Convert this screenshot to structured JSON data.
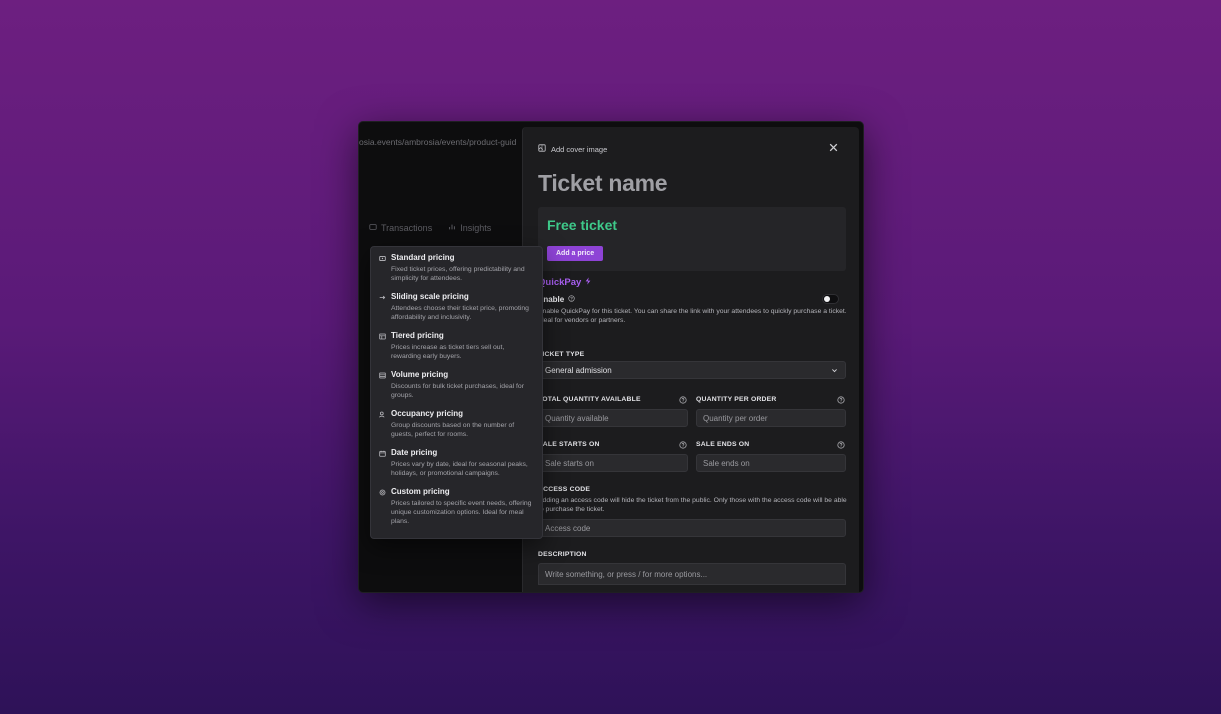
{
  "background_window": {
    "url": "osia.events/ambrosia/events/product-guid",
    "tabs": [
      {
        "label": "Transactions",
        "icon": "card-icon"
      },
      {
        "label": "Insights",
        "icon": "chart-icon"
      }
    ]
  },
  "pricing_menu": {
    "items": [
      {
        "icon": "tag-icon",
        "title": "Standard pricing",
        "desc": "Fixed ticket prices, offering predictability and simplicity for attendees."
      },
      {
        "icon": "arrow-right-icon",
        "title": "Sliding scale pricing",
        "desc": "Attendees choose their ticket price, promoting affordability and inclusivity."
      },
      {
        "icon": "layers-icon",
        "title": "Tiered pricing",
        "desc": "Prices increase as ticket tiers sell out, rewarding early buyers."
      },
      {
        "icon": "stack-icon",
        "title": "Volume pricing",
        "desc": "Discounts for bulk ticket purchases, ideal for groups."
      },
      {
        "icon": "people-icon",
        "title": "Occupancy pricing",
        "desc": "Group discounts based on the number of guests, perfect for rooms."
      },
      {
        "icon": "calendar-icon",
        "title": "Date pricing",
        "desc": "Prices vary by date, ideal for seasonal peaks, holidays, or promotional campaigns."
      },
      {
        "icon": "settings-icon",
        "title": "Custom pricing",
        "desc": "Prices tailored to specific event needs, offering unique customization options. Ideal for meal plans."
      }
    ]
  },
  "panel": {
    "add_cover_label": "Add cover image",
    "ticket_name_placeholder": "Ticket name",
    "free_ticket_label": "Free ticket",
    "add_price_label": "Add a price",
    "quickpay": {
      "title": "QuickPay",
      "enable_label": "Enable",
      "enabled": false,
      "description": "Enable QuickPay for this ticket. You can share the link with your attendees to quickly purchase a ticket. Ideal for vendors or partners."
    },
    "ticket_type": {
      "label": "TICKET TYPE",
      "value": "General admission"
    },
    "total_quantity": {
      "label": "TOTAL QUANTITY AVAILABLE",
      "placeholder": "Quantity available"
    },
    "quantity_per_order": {
      "label": "QUANTITY PER ORDER",
      "placeholder": "Quantity per order"
    },
    "sale_starts": {
      "label": "SALE STARTS ON",
      "placeholder": "Sale starts on"
    },
    "sale_ends": {
      "label": "SALE ENDS ON",
      "placeholder": "Sale ends on"
    },
    "access_code": {
      "label": "ACCESS CODE",
      "description": "Adding an access code will hide the ticket from the public. Only those with the access code will be able to purchase the ticket.",
      "placeholder": "Access code"
    },
    "description": {
      "label": "DESCRIPTION",
      "placeholder": "Write something, or press / for more options..."
    }
  },
  "colors": {
    "accent": "#8e43d6",
    "quickpay": "#a85ff0",
    "free_ticket": "#3ec98a",
    "panel_bg": "#1c1c1e"
  }
}
